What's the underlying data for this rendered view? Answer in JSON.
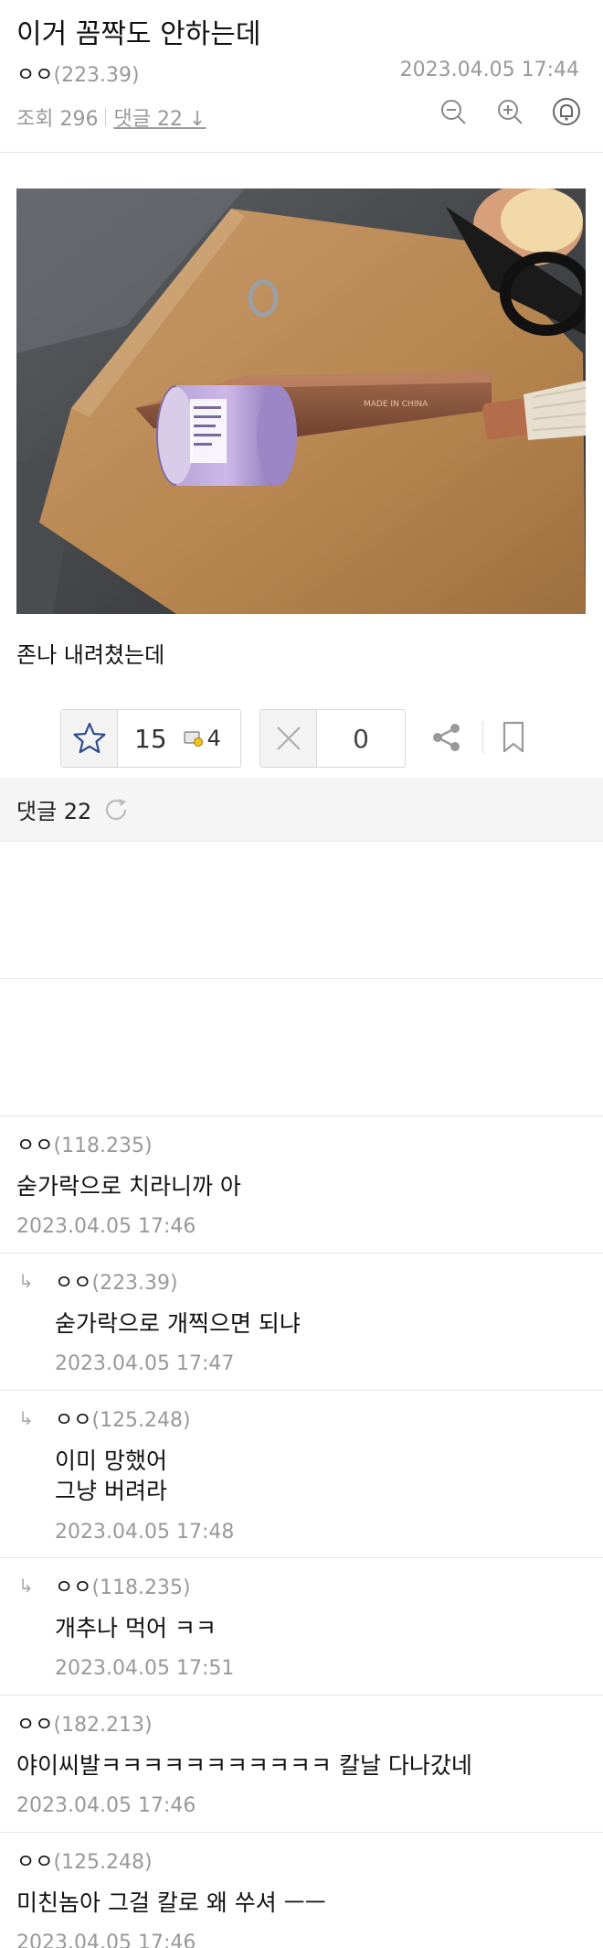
{
  "post": {
    "title": "이거 꼼짝도 안하는데",
    "author": "ㅇㅇ",
    "author_ip": "(223.39)",
    "date": "2023.04.05 17:44",
    "views": "조회 296",
    "comments_link": "댓글 22",
    "body": "존나 내려쳤는데"
  },
  "toolbar": {
    "icons": [
      "zoom-out-icon",
      "zoom-in-icon",
      "bell-icon"
    ]
  },
  "photo_text": {
    "knife_print": "MADE IN CHINA"
  },
  "votes": {
    "up": "15",
    "fixed": "4",
    "down": "0"
  },
  "comments_header": {
    "label": "댓글 22"
  },
  "comments": [
    {
      "author": "ㅇㅇ",
      "ip": "(118.235)",
      "text": "숟가락으로 치라니까 아",
      "date": "2023.04.05 17:46",
      "reply": false
    },
    {
      "author": "ㅇㅇ",
      "ip": "(223.39)",
      "text": "숟가락으로 개찍으면 되냐",
      "date": "2023.04.05 17:47",
      "reply": true
    },
    {
      "author": "ㅇㅇ",
      "ip": "(125.248)",
      "text": "이미 망했어\n그냥 버려라",
      "date": "2023.04.05 17:48",
      "reply": true
    },
    {
      "author": "ㅇㅇ",
      "ip": "(118.235)",
      "text": "개추나 먹어 ㅋㅋ",
      "date": "2023.04.05 17:51",
      "reply": true
    },
    {
      "author": "ㅇㅇ",
      "ip": "(182.213)",
      "text": "야이씨발ㅋㅋㅋㅋㅋㅋㅋㅋㅋㅋㅋ 칼날 다나갔네",
      "date": "2023.04.05 17:46",
      "reply": false
    },
    {
      "author": "ㅇㅇ",
      "ip": "(125.248)",
      "text": "미친놈아 그걸 칼로 왜 쑤셔 ㅡㅡ",
      "date": "2023.04.05 17:46",
      "reply": false
    }
  ]
}
